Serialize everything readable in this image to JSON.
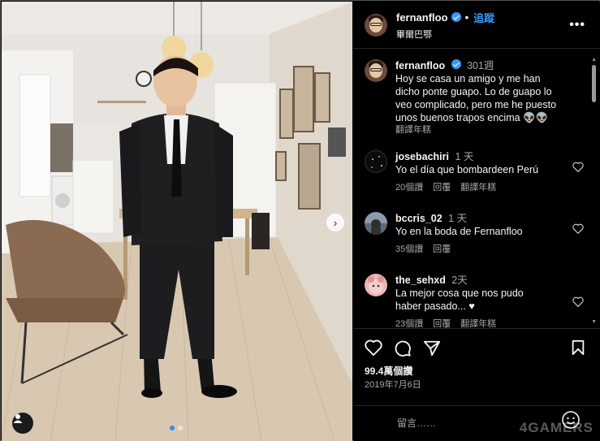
{
  "post": {
    "username": "fernanfloo",
    "follow_label": "追蹤",
    "location": "畢爾巴鄂",
    "more_label": "•••"
  },
  "caption": {
    "username": "fernanfloo",
    "time": "301週",
    "lines": [
      "Hoy se casa un amigo y me han",
      "dicho ponte guapo. Lo de guapo lo",
      "veo complicado, pero me he puesto",
      "unos buenos trapos encima 👽👽"
    ],
    "translate_label": "翻譯年糕"
  },
  "comments": [
    {
      "username": "josebachiri",
      "time": "1 天",
      "text": "Yo el día que bombardeen Perú",
      "likes": "20個讚",
      "reply": "回覆",
      "translate": "翻譯年糕"
    },
    {
      "username": "bccris_02",
      "time": "1 天",
      "text": "Yo en la boda de Fernanfloo",
      "likes": "35個讚",
      "reply": "回覆"
    },
    {
      "username": "the_sehxd",
      "time": "2天",
      "text": "La mejor cosa que nos pudo",
      "text2": "haber pasado... ♥",
      "likes": "23個讚",
      "reply": "回覆",
      "translate": "翻譯年糕"
    }
  ],
  "stats": {
    "likes": "99.4萬個讚",
    "date": "2019年7月6日"
  },
  "compose": {
    "placeholder": "留言……"
  },
  "watermark": "4GAMERS",
  "colors": {
    "accent": "#3897f0",
    "background": "#000000",
    "muted": "#a8a8a8"
  },
  "icons": [
    "heart-icon",
    "comment-icon",
    "share-icon",
    "bookmark-icon",
    "emoji-icon",
    "user-tag-icon",
    "chevron-right-icon",
    "verified-icon"
  ]
}
